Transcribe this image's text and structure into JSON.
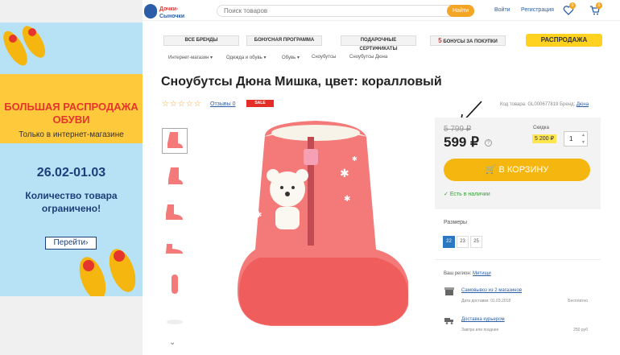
{
  "banner": {
    "title": "БОЛЬШАЯ РАСПРОДАЖА ОБУВИ",
    "subtitle": "Только в интернет-магазине",
    "dates": "26.02-01.03",
    "note": "Количество товара ограничено!",
    "button": "Перейти›"
  },
  "header": {
    "logo_alt": "Дочки-Сыночки",
    "search_placeholder": "Поиск товаров",
    "search_button": "Найти",
    "login": "Войти",
    "register": "Регистрация",
    "fav_count": "0",
    "cart_count": "6"
  },
  "nav": {
    "brands": "ВСЕ БРЕНДЫ",
    "bonus": "БОНУСНАЯ ПРОГРАММА",
    "gift": "ПОДАРОЧНЫЕ СЕРТИФИКАТЫ",
    "bonus_buy": "БОНУСЫ ЗА ПОКУПКИ",
    "sale": "РАСПРОДАЖА"
  },
  "breadcrumb": [
    "Интернет-магазин ▾",
    "Одежда и обувь ▾",
    "Обувь ▾",
    "Сноубутсы",
    "Сноубутсы Дюна"
  ],
  "product": {
    "title": "Сноубутсы Дюна Мишка, цвет: коралловый",
    "stars": "☆☆☆☆☆",
    "reviews": "Отзывы 0",
    "sale_badge": "SALE",
    "code_label": "Код товара: GL000677819",
    "brand_label": "Бренд:",
    "brand": "Дюна"
  },
  "buy": {
    "old_price": "5 799 ₽",
    "price": "599 ₽",
    "question": "?",
    "discount_label": "Скидка",
    "discount": "5 200 ₽",
    "qty": "1",
    "to_cart": "В КОРЗИНУ",
    "in_stock": "Есть в наличии"
  },
  "sizes": {
    "label": "Размеры",
    "items": [
      "22",
      "23",
      "25"
    ],
    "selected": "22"
  },
  "delivery": {
    "region_label": "Ваш регион:",
    "region": "Митищи",
    "pickup": "Самовывоз из 2 магазинов",
    "pickup_date": "Дата доставки: 01.03.2018",
    "pickup_price": "Бесплатно",
    "courier": "Доставка курьером",
    "courier_date": "Завтра или позднее",
    "courier_price": "250 руб"
  },
  "colors": {
    "accent": "#f5b70f",
    "sale_red": "#e52d28",
    "link": "#2b5ea6",
    "boot": "#f37a78"
  }
}
